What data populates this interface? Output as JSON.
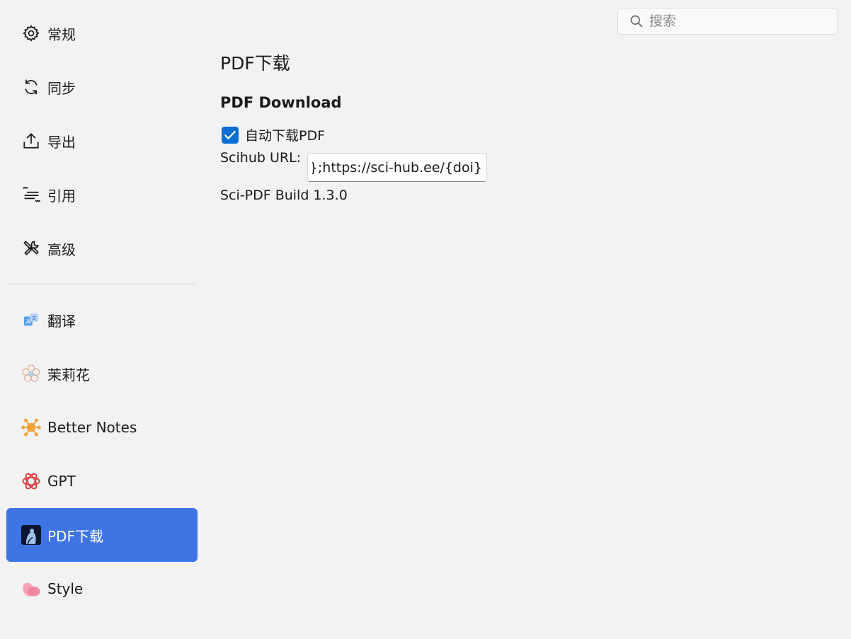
{
  "sidebar": {
    "items": [
      {
        "label": "常规",
        "icon": "gear-icon"
      },
      {
        "label": "同步",
        "icon": "sync-icon"
      },
      {
        "label": "导出",
        "icon": "export-icon"
      },
      {
        "label": "引用",
        "icon": "cite-icon"
      },
      {
        "label": "高级",
        "icon": "tools-icon"
      },
      {
        "label": "翻译",
        "icon": "translate-icon"
      },
      {
        "label": "茉莉花",
        "icon": "jasmine-icon"
      },
      {
        "label": "Better Notes",
        "icon": "better-notes-icon"
      },
      {
        "label": "GPT",
        "icon": "gpt-icon"
      },
      {
        "label": "PDF下载",
        "icon": "sci-pdf-icon",
        "active": true
      },
      {
        "label": "Style",
        "icon": "style-icon"
      }
    ]
  },
  "search": {
    "placeholder": "搜索"
  },
  "main": {
    "page_title": "PDF下载",
    "section_title": "PDF Download",
    "auto_download": {
      "label": "自动下载PDF",
      "checked": true
    },
    "scihub": {
      "label": "Scihub URL:",
      "value": "oi};https://sci-hub.ee/{doi}"
    },
    "build": "Sci-PDF Build 1.3.0"
  },
  "colors": {
    "accent": "#3f74e4",
    "checkbox": "#0a6fd1",
    "background": "#f2f2f2"
  }
}
